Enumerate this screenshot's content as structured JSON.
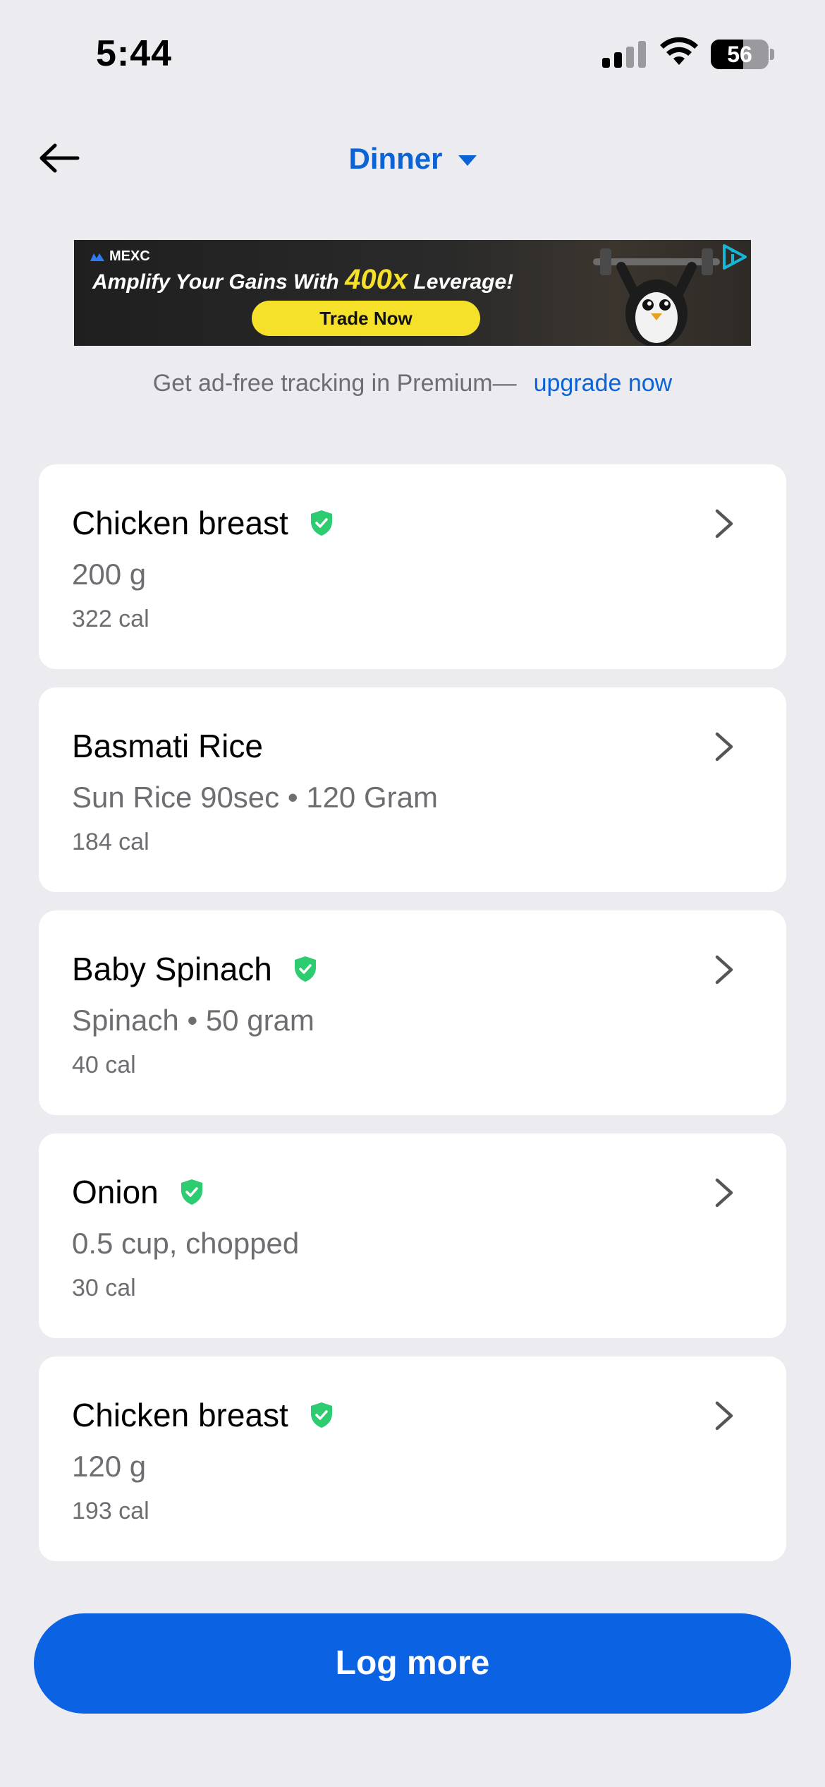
{
  "status_bar": {
    "time": "5:44",
    "battery": "56",
    "battery_level": 0.56
  },
  "header": {
    "meal": "Dinner"
  },
  "ad": {
    "brand": "MEXC",
    "headline_pre": "Amplify Your Gains With ",
    "headline_big": "400x",
    "headline_post": " Leverage!",
    "cta": "Trade Now"
  },
  "premium": {
    "text": "Get ad-free tracking in Premium—",
    "link": "upgrade now"
  },
  "foods": [
    {
      "name": "Chicken breast",
      "verified": true,
      "detail": "200 g",
      "calories": "322 cal"
    },
    {
      "name": "Basmati Rice",
      "verified": false,
      "detail": "Sun Rice 90sec • 120 Gram",
      "calories": "184 cal"
    },
    {
      "name": "Baby Spinach",
      "verified": true,
      "detail": "Spinach • 50 gram",
      "calories": "40 cal"
    },
    {
      "name": "Onion",
      "verified": true,
      "detail": "0.5 cup, chopped",
      "calories": "30 cal"
    },
    {
      "name": "Chicken breast",
      "verified": true,
      "detail": "120 g",
      "calories": "193 cal"
    }
  ],
  "actions": {
    "log_more": "Log more"
  },
  "colors": {
    "accent": "#0b63d6",
    "button": "#0b63e4",
    "verified": "#2ecc71",
    "background": "#ebebf0"
  }
}
